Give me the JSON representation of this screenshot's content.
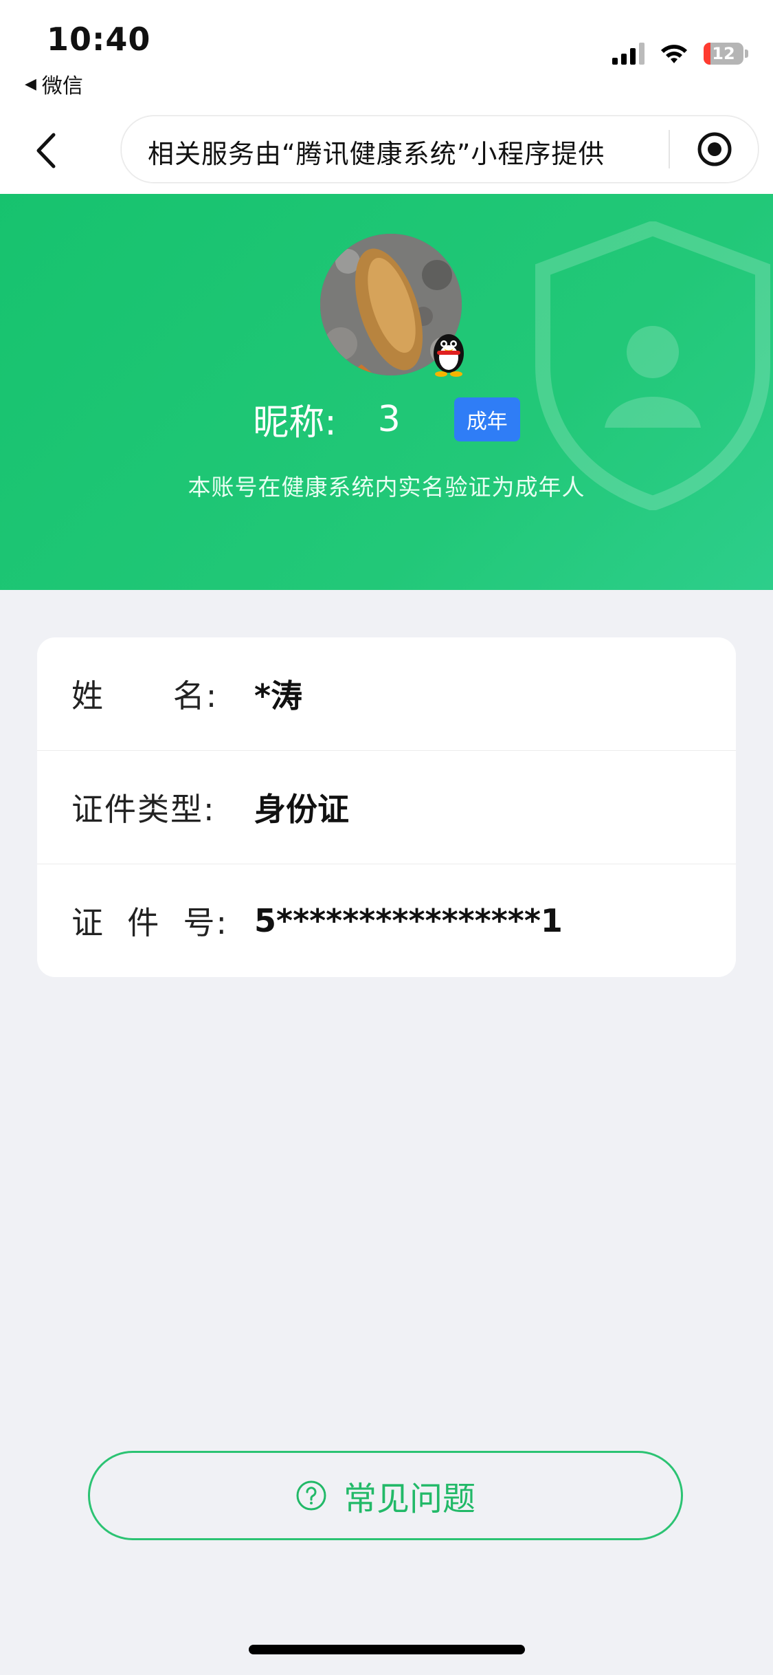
{
  "status_bar": {
    "time": "10:40",
    "back_app": "微信",
    "battery": "12"
  },
  "navbar": {
    "capsule_text": "相关服务由“腾讯健康系统”小程序提供"
  },
  "profile": {
    "nickname_label": "昵称:",
    "nickname_value": "3",
    "badge": "成年",
    "verify_text": "本账号在健康系统内实名验证为成年人"
  },
  "identity": {
    "rows": [
      {
        "label": "姓      名:",
        "value": "*涛"
      },
      {
        "label": "证件类型:",
        "value": "身份证"
      },
      {
        "label": "证  件  号:",
        "value": "5****************1"
      }
    ]
  },
  "faq": {
    "label": "常见问题"
  },
  "colors": {
    "brand_green": "#1fc474",
    "badge_blue": "#2f7df6",
    "page_bg": "#f0f1f5"
  }
}
